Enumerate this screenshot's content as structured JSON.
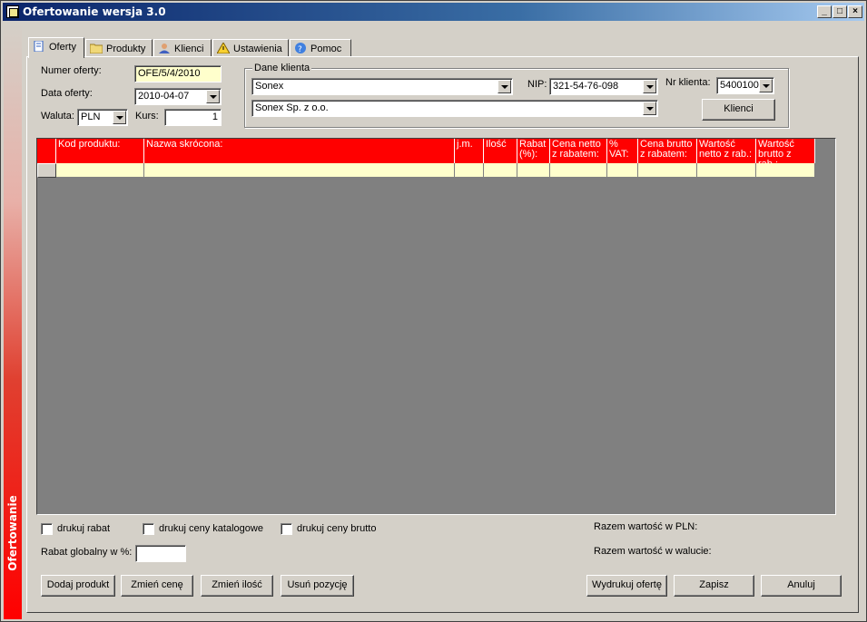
{
  "window": {
    "title": "Ofertowanie wersja 3.0",
    "sidebar_label": "Ofertowanie"
  },
  "tabs": [
    {
      "label": "Oferty",
      "icon": "document-icon",
      "active": true
    },
    {
      "label": "Produkty",
      "icon": "folder-icon",
      "active": false
    },
    {
      "label": "Klienci",
      "icon": "user-icon",
      "active": false
    },
    {
      "label": "Ustawienia",
      "icon": "warning-icon",
      "active": false
    },
    {
      "label": "Pomoc",
      "icon": "help-icon",
      "active": false
    }
  ],
  "offer": {
    "number_label": "Numer oferty:",
    "number_value": "OFE/5/4/2010",
    "date_label": "Data oferty:",
    "date_value": "2010-04-07",
    "currency_label": "Waluta:",
    "currency_value": "PLN",
    "rate_label": "Kurs:",
    "rate_value": "1"
  },
  "client": {
    "group_label": "Dane klienta",
    "name_value": "Sonex",
    "fullname_value": "Sonex Sp. z o.o.",
    "nip_label": "NIP:",
    "nip_value": "321-54-76-098",
    "nr_label": "Nr klienta:",
    "nr_value": "5400100",
    "clients_button": "Klienci"
  },
  "grid": {
    "columns": [
      "Kod produktu:",
      "Nazwa skrócona:",
      "j.m.",
      "Ilość",
      "Rabat (%):",
      "Cena netto z rabatem:",
      "% VAT:",
      "Cena brutto z rabatem:",
      "Wartość netto z rab.:",
      "Wartość brutto z rab.:"
    ]
  },
  "options": {
    "print_discount": "drukuj rabat",
    "print_catalog_prices": "drukuj ceny katalogowe",
    "print_gross_prices": "drukuj ceny brutto",
    "global_discount_label": "Rabat globalny w %:",
    "global_discount_value": ""
  },
  "totals": {
    "pln_label": "Razem wartość w PLN:",
    "currency_label": "Razem wartość w walucie:"
  },
  "buttons": {
    "add_product": "Dodaj produkt",
    "change_price": "Zmień cenę",
    "change_quantity": "Zmień ilość",
    "delete_item": "Usuń pozycję",
    "print_offer": "Wydrukuj ofertę",
    "save": "Zapisz",
    "cancel": "Anuluj"
  },
  "colors": {
    "header_red": "#ff0000",
    "input_yellow": "#ffffcc",
    "title_blue": "#0a246a"
  }
}
